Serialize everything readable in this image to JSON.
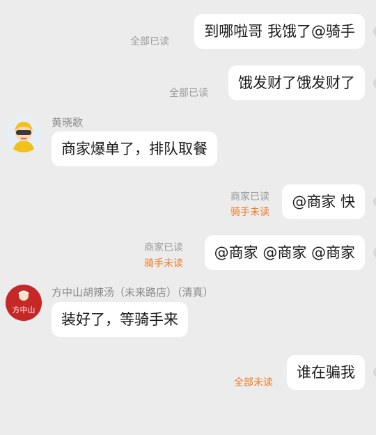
{
  "colors": {
    "background": "#ececec",
    "bubble": "#ffffff",
    "status_read": "#9a9a9a",
    "status_unread": "#f07a22"
  },
  "messages": [
    {
      "text": "到哪啦哥 我饿了@骑手",
      "status": "全部已读"
    },
    {
      "text": "饿发财了饿发财了",
      "status": "全部已读"
    },
    {
      "sender": "黄晓歌",
      "text": "商家爆单了，排队取餐",
      "avatar_icon": "cartoon-avatar-icon"
    },
    {
      "text": "@商家 快",
      "status_merchant": "商家已读",
      "status_rider": "骑手未读"
    },
    {
      "text": "@商家 @商家 @商家",
      "status_merchant": "商家已读",
      "status_rider": "骑手未读"
    },
    {
      "sender": "方中山胡辣汤（未来路店）（清真）",
      "text": "装好了，等骑手来",
      "avatar_icon": "shop-logo-icon",
      "avatar_text": "方中山"
    },
    {
      "text": "谁在骗我",
      "status": "全部未读"
    }
  ]
}
